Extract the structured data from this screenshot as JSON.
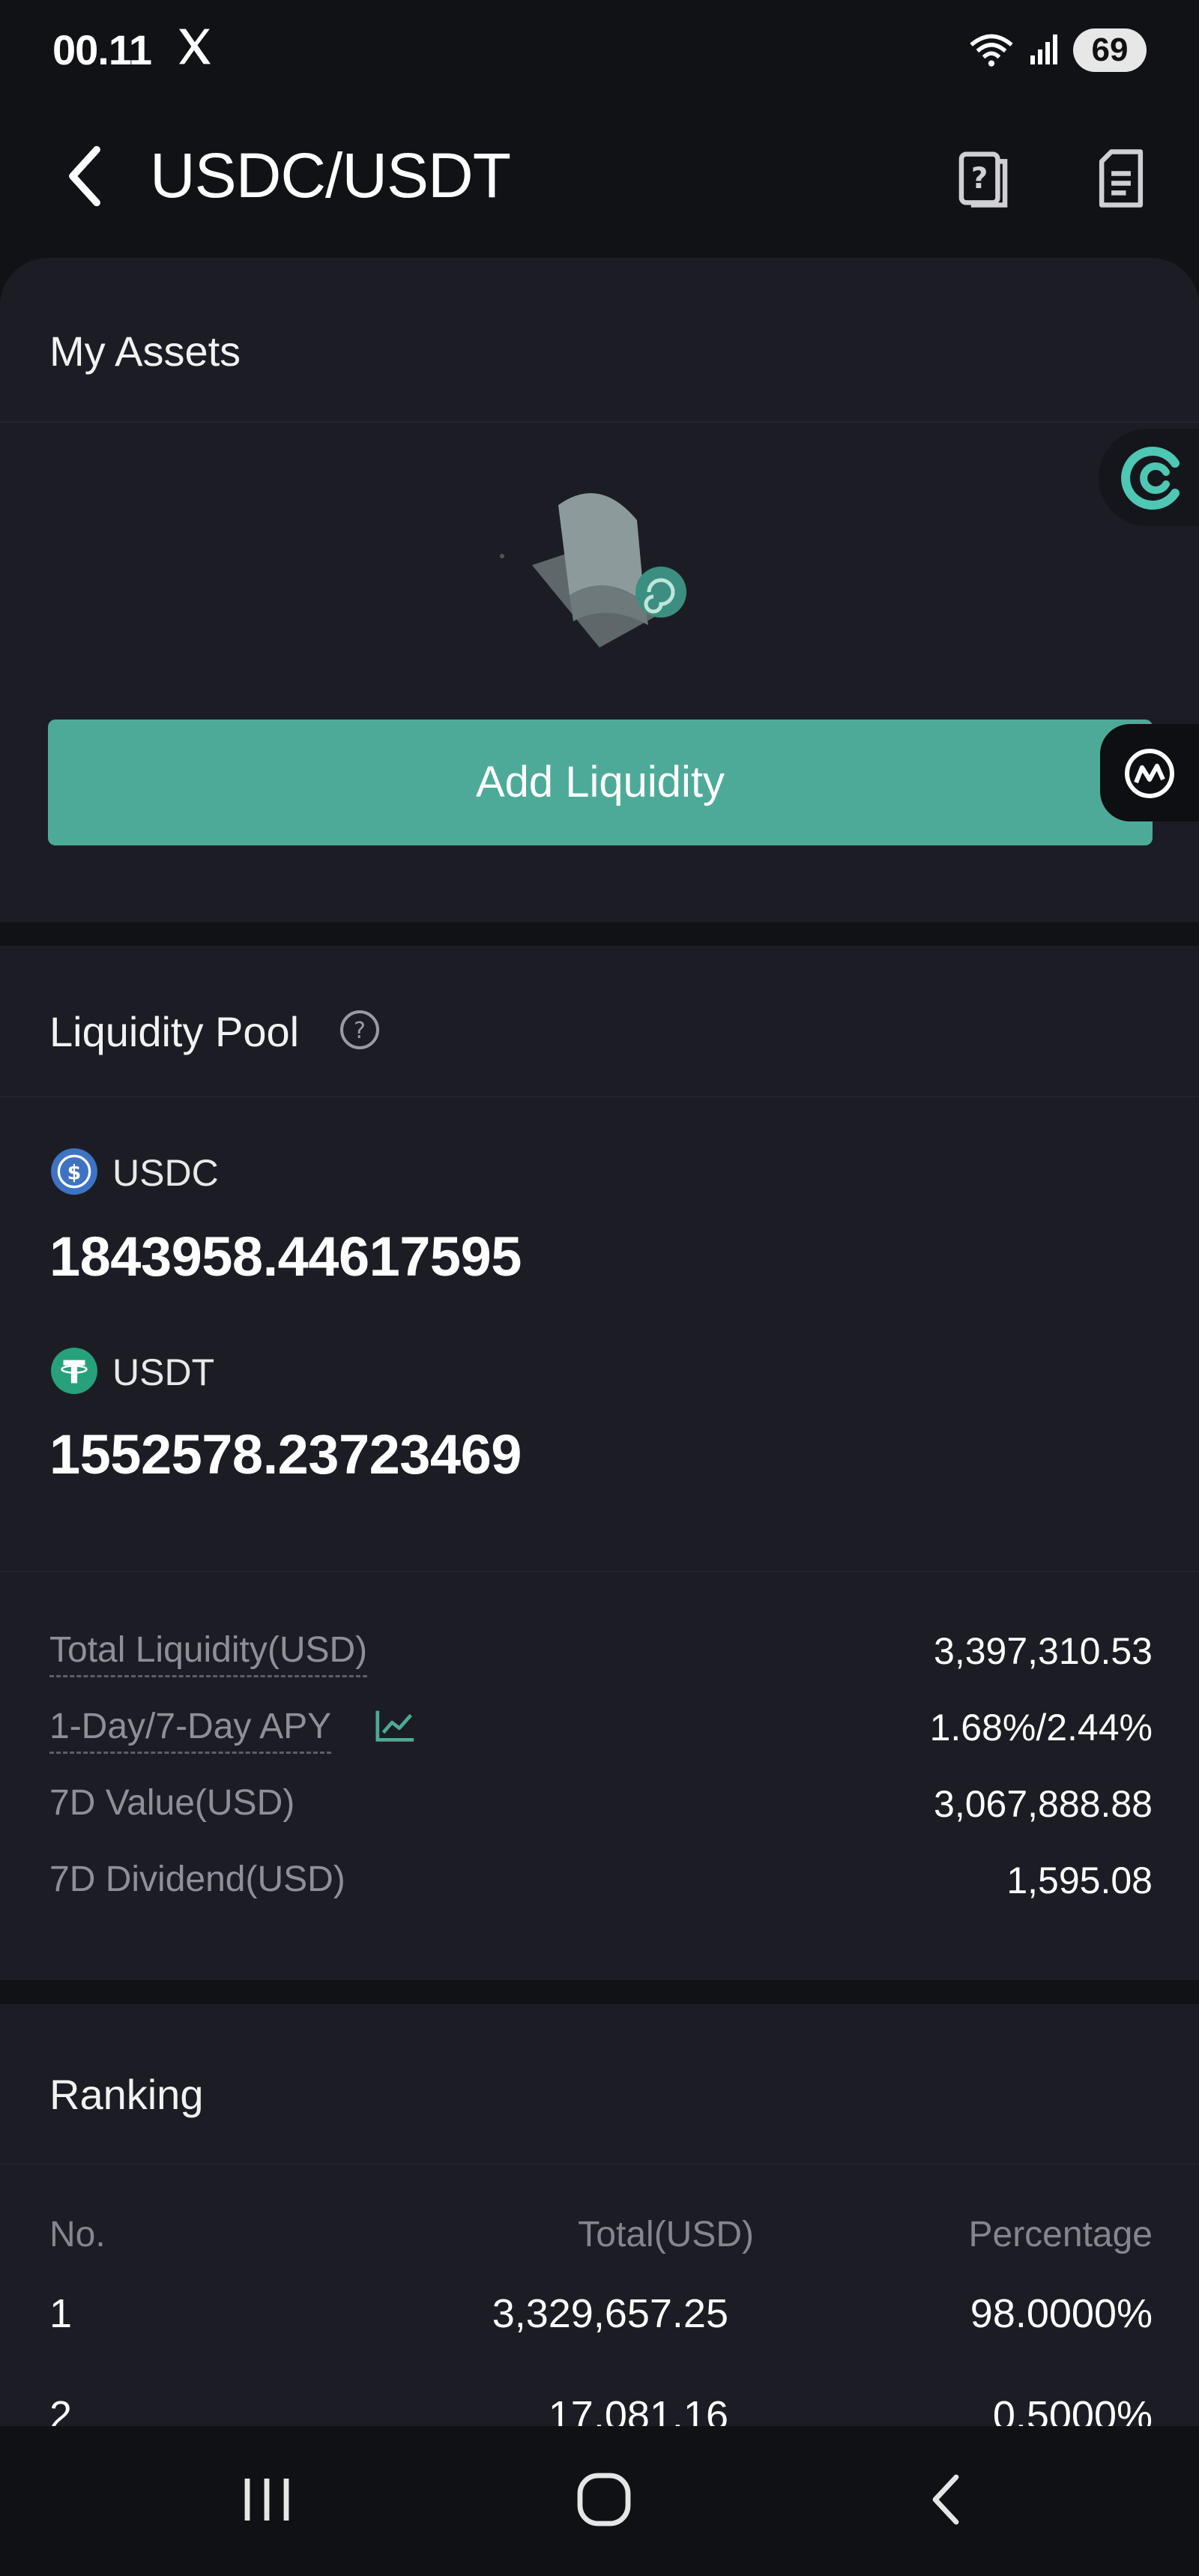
{
  "status_bar": {
    "time": "00.11",
    "battery": "69"
  },
  "header": {
    "title": "USDC/USDT"
  },
  "my_assets": {
    "title": "My Assets",
    "add_liquidity_label": "Add Liquidity"
  },
  "liquidity_pool": {
    "title": "Liquidity Pool",
    "tokens": [
      {
        "symbol": "USDC",
        "amount": "1843958.44617595"
      },
      {
        "symbol": "USDT",
        "amount": "1552578.23723469"
      }
    ],
    "stats": [
      {
        "label": "Total Liquidity(USD)",
        "value": "3,397,310.53"
      },
      {
        "label": "1-Day/7-Day APY",
        "value": "1.68%/2.44%"
      },
      {
        "label": "7D Value(USD)",
        "value": "3,067,888.88"
      },
      {
        "label": "7D Dividend(USD)",
        "value": "1,595.08"
      }
    ]
  },
  "ranking": {
    "title": "Ranking",
    "columns": [
      "No.",
      "Total(USD)",
      "Percentage"
    ],
    "rows": [
      [
        "1",
        "3,329,657.25",
        "98.0000%"
      ],
      [
        "2",
        "17,081.16",
        "0.5000%"
      ]
    ]
  },
  "colors": {
    "accent": "#4eaa98",
    "background": "#111216",
    "card": "#1c1d24",
    "usdc": "#3e73c4",
    "usdt": "#26a17b"
  }
}
